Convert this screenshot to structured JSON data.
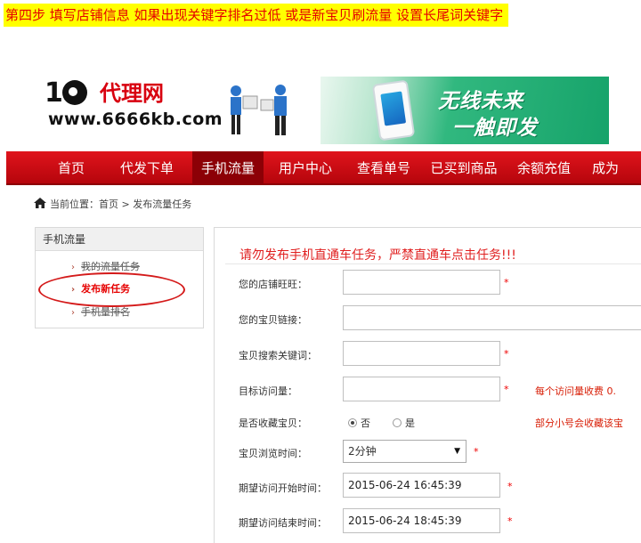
{
  "instruction": "第四步 填写店铺信息   如果出现关键字排名过低 或是新宝贝刷流量  设置长尾词关键字",
  "brand": {
    "logo_mark": "1",
    "name": "代理网",
    "url": "www.6666kb.com"
  },
  "banner": {
    "line1": "无线未来",
    "line2": "一触即发"
  },
  "nav": {
    "items": [
      {
        "label": "首页"
      },
      {
        "label": "代发下单"
      },
      {
        "label": "手机流量"
      },
      {
        "label": "用户中心"
      },
      {
        "label": "查看单号"
      },
      {
        "label": "已买到商品"
      },
      {
        "label": "余额充值"
      },
      {
        "label": "成为"
      }
    ],
    "active": "手机流量"
  },
  "breadcrumb": {
    "prefix": "当前位置：",
    "home": "首页",
    "separator": ">",
    "current": "发布流量任务"
  },
  "sidebar": {
    "title": "手机流量",
    "items": [
      {
        "label": "我的流量任务"
      },
      {
        "label": "发布新任务"
      },
      {
        "label": "手机量排名"
      }
    ]
  },
  "form": {
    "warning": "请勿发布手机直通车任务，严禁直通车点击任务!!!",
    "shop_label": "您的店铺旺旺：",
    "shop_value": "",
    "link_label": "您的宝贝链接：",
    "link_value": "",
    "keyword_label": "宝贝搜索关键词：",
    "keyword_value": "",
    "visits_label": "目标访问量：",
    "visits_value": "",
    "visits_hint": "每个访问量收费 0.",
    "favorite_label": "是否收藏宝贝：",
    "favorite_no": "否",
    "favorite_yes": "是",
    "favorite_selected": "否",
    "favorite_hint": "部分小号会收藏该宝",
    "browse_label": "宝贝浏览时间：",
    "browse_value": "2分钟",
    "start_label": "期望访问开始时间：",
    "start_value": "2015-06-24 16:45:39",
    "end_label": "期望访问结束时间：",
    "end_value": "2015-06-24 18:45:39",
    "required_mark": "*"
  }
}
